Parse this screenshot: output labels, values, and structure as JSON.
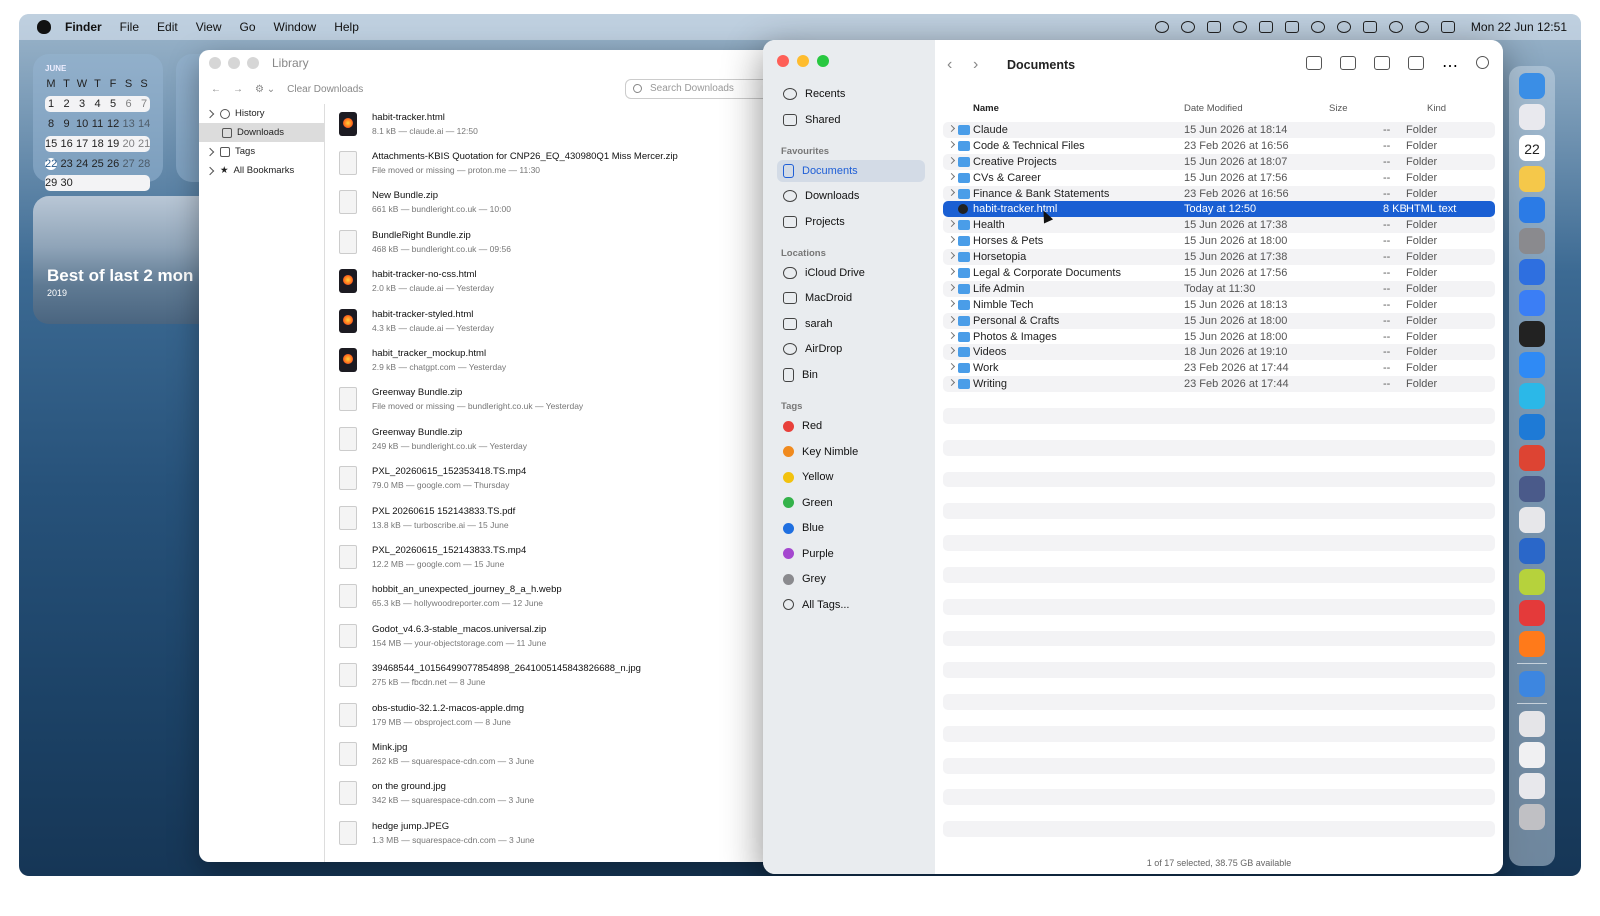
{
  "menubar": {
    "app": "Finder",
    "items": [
      "File",
      "Edit",
      "View",
      "Go",
      "Window",
      "Help"
    ],
    "clock": "Mon 22 Jun  12:51"
  },
  "calendar": {
    "month": "JUNE",
    "days_header": [
      "M",
      "T",
      "W",
      "T",
      "F",
      "S",
      "S"
    ],
    "weeks": [
      [
        "1",
        "2",
        "3",
        "4",
        "5",
        "6",
        "7"
      ],
      [
        "8",
        "9",
        "10",
        "11",
        "12",
        "13",
        "14"
      ],
      [
        "15",
        "16",
        "17",
        "18",
        "19",
        "20",
        "21"
      ],
      [
        "22",
        "23",
        "24",
        "25",
        "26",
        "27",
        "28"
      ],
      [
        "29",
        "30",
        "",
        "",
        "",
        "",
        ""
      ]
    ]
  },
  "photo_widget": {
    "title": "Best of last 2 mon",
    "year": "2019"
  },
  "library": {
    "title": "Library",
    "clear": "Clear Downloads",
    "search_placeholder": "Search Downloads",
    "sidebar": [
      "History",
      "Downloads",
      "Tags",
      "All Bookmarks"
    ],
    "downloads": [
      {
        "name": "habit-tracker.html",
        "sub": "8.1 kB — claude.ai — 12:50",
        "icon": "firefox"
      },
      {
        "name": "Attachments-KBIS Quotation for CNP26_EQ_430980Q1 Miss Mercer.zip",
        "sub": "File moved or missing — proton.me — 11:30",
        "icon": "file"
      },
      {
        "name": "New Bundle.zip",
        "sub": "661 kB — bundleright.co.uk — 10:00",
        "icon": "file"
      },
      {
        "name": "BundleRight Bundle.zip",
        "sub": "468 kB — bundleright.co.uk — 09:56",
        "icon": "file"
      },
      {
        "name": "habit-tracker-no-css.html",
        "sub": "2.0 kB — claude.ai — Yesterday",
        "icon": "firefox"
      },
      {
        "name": "habit-tracker-styled.html",
        "sub": "4.3 kB — claude.ai — Yesterday",
        "icon": "firefox"
      },
      {
        "name": "habit_tracker_mockup.html",
        "sub": "2.9 kB — chatgpt.com — Yesterday",
        "icon": "firefox"
      },
      {
        "name": "Greenway Bundle.zip",
        "sub": "File moved or missing — bundleright.co.uk — Yesterday",
        "icon": "file"
      },
      {
        "name": "Greenway Bundle.zip",
        "sub": "249 kB — bundleright.co.uk — Yesterday",
        "icon": "file"
      },
      {
        "name": "PXL_20260615_152353418.TS.mp4",
        "sub": "79.0 MB — google.com — Thursday",
        "icon": "file"
      },
      {
        "name": "PXL 20260615 152143833.TS.pdf",
        "sub": "13.8 kB — turboscribe.ai — 15 June",
        "icon": "file"
      },
      {
        "name": "PXL_20260615_152143833.TS.mp4",
        "sub": "12.2 MB — google.com — 15 June",
        "icon": "file"
      },
      {
        "name": "hobbit_an_unexpected_journey_8_a_h.webp",
        "sub": "65.3 kB — hollywoodreporter.com — 12 June",
        "icon": "file"
      },
      {
        "name": "Godot_v4.6.3-stable_macos.universal.zip",
        "sub": "154 MB — your-objectstorage.com — 11 June",
        "icon": "file"
      },
      {
        "name": "39468544_10156499077854898_2641005145843826688_n.jpg",
        "sub": "275 kB — fbcdn.net — 8 June",
        "icon": "file"
      },
      {
        "name": "obs-studio-32.1.2-macos-apple.dmg",
        "sub": "179 MB — obsproject.com — 8 June",
        "icon": "file"
      },
      {
        "name": "Mink.jpg",
        "sub": "262 kB — squarespace-cdn.com — 3 June",
        "icon": "file"
      },
      {
        "name": "on the ground.jpg",
        "sub": "342 kB — squarespace-cdn.com — 3 June",
        "icon": "file"
      },
      {
        "name": "hedge jump.JPEG",
        "sub": "1.3 MB — squarespace-cdn.com — 3 June",
        "icon": "file"
      }
    ]
  },
  "finder": {
    "title": "Documents",
    "sidebar": {
      "top": [
        "Recents",
        "Shared"
      ],
      "favourites_label": "Favourites",
      "favourites": [
        "Documents",
        "Downloads",
        "Projects"
      ],
      "locations_label": "Locations",
      "locations": [
        "iCloud Drive",
        "MacDroid",
        "sarah",
        "AirDrop",
        "Bin"
      ],
      "tags_label": "Tags",
      "tags": [
        {
          "name": "Red",
          "color": "#e8403a"
        },
        {
          "name": "Key Nimble",
          "color": "#f08a1e"
        },
        {
          "name": "Yellow",
          "color": "#f2c20e"
        },
        {
          "name": "Green",
          "color": "#34b24a"
        },
        {
          "name": "Blue",
          "color": "#1f6fe0"
        },
        {
          "name": "Purple",
          "color": "#a447cf"
        },
        {
          "name": "Grey",
          "color": "#8a8a8e"
        },
        {
          "name": "All Tags...",
          "color": ""
        }
      ]
    },
    "columns": {
      "name": "Name",
      "date": "Date Modified",
      "size": "Size",
      "kind": "Kind"
    },
    "rows": [
      {
        "name": "Claude",
        "date": "15 Jun 2026 at 18:14",
        "size": "--",
        "kind": "Folder"
      },
      {
        "name": "Code & Technical Files",
        "date": "23 Feb 2026 at 16:56",
        "size": "--",
        "kind": "Folder"
      },
      {
        "name": "Creative Projects",
        "date": "15 Jun 2026 at 18:07",
        "size": "--",
        "kind": "Folder"
      },
      {
        "name": "CVs & Career",
        "date": "15 Jun 2026 at 17:56",
        "size": "--",
        "kind": "Folder"
      },
      {
        "name": "Finance & Bank Statements",
        "date": "23 Feb 2026 at 16:56",
        "size": "--",
        "kind": "Folder"
      },
      {
        "name": "habit-tracker.html",
        "date": "Today at 12:50",
        "size": "8 KB",
        "kind": "HTML text",
        "selected": true
      },
      {
        "name": "Health",
        "date": "15 Jun 2026 at 17:38",
        "size": "--",
        "kind": "Folder"
      },
      {
        "name": "Horses & Pets",
        "date": "15 Jun 2026 at 18:00",
        "size": "--",
        "kind": "Folder"
      },
      {
        "name": "Horsetopia",
        "date": "15 Jun 2026 at 17:38",
        "size": "--",
        "kind": "Folder"
      },
      {
        "name": "Legal & Corporate Documents",
        "date": "15 Jun 2026 at 17:56",
        "size": "--",
        "kind": "Folder"
      },
      {
        "name": "Life Admin",
        "date": "Today at 11:30",
        "size": "--",
        "kind": "Folder"
      },
      {
        "name": "Nimble Tech",
        "date": "15 Jun 2026 at 18:13",
        "size": "--",
        "kind": "Folder"
      },
      {
        "name": "Personal & Crafts",
        "date": "15 Jun 2026 at 18:00",
        "size": "--",
        "kind": "Folder"
      },
      {
        "name": "Photos & Images",
        "date": "15 Jun 2026 at 18:00",
        "size": "--",
        "kind": "Folder"
      },
      {
        "name": "Videos",
        "date": "18 Jun 2026 at 19:10",
        "size": "--",
        "kind": "Folder"
      },
      {
        "name": "Work",
        "date": "23 Feb 2026 at 17:44",
        "size": "--",
        "kind": "Folder"
      },
      {
        "name": "Writing",
        "date": "23 Feb 2026 at 17:44",
        "size": "--",
        "kind": "Folder"
      }
    ],
    "status": "1 of 17 selected, 38.75 GB available"
  },
  "dock": {
    "calendar_date": "22",
    "apps": [
      "#3a8ee6",
      "#e9e9ee",
      "#ffffff",
      "#f5c84a",
      "#2b7be6",
      "#8a8a8e",
      "#2e6fe0",
      "#3b7ef5",
      "#222222",
      "#2f8af5",
      "#2bb8e8",
      "#1e7ad6",
      "#dd4433",
      "#4a5a8a",
      "#e7e7ea",
      "#2a67c9",
      "#b6d23c",
      "#e43a3a",
      "#ff7a1a",
      "#3d86e0",
      "#e5e5e8",
      "#f0f0f2",
      "#e8e8ec",
      "#c0c0c4"
    ]
  }
}
